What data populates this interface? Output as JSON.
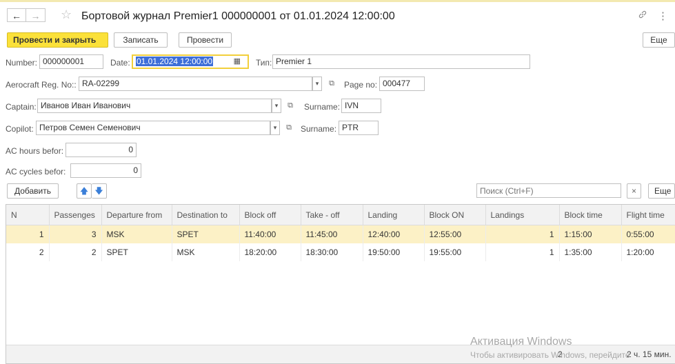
{
  "window": {
    "title": "Бортовой журнал Premier1 000000001 от 01.01.2024 12:00:00",
    "back": "←",
    "forward": "→",
    "star": "☆",
    "link_icon": "🔗",
    "more_icon": "⋮"
  },
  "toolbar": {
    "post_close": "Провести и закрыть",
    "save": "Записать",
    "post": "Провести",
    "more": "Еще"
  },
  "form": {
    "number_label": "Number:",
    "number_value": "000000001",
    "date_label": "Date:",
    "date_value": "01.01.2024 12:00:00",
    "type_label": "Тип:",
    "type_value": "Premier 1",
    "reg_label": "Aerocraft Reg. No::",
    "reg_value": "RA-02299",
    "page_label": "Page no:",
    "page_value": "000477",
    "captain_label": "Captain:",
    "captain_value": "Иванов Иван Иванович",
    "captain_surname_label": "Surname:",
    "captain_surname_value": "IVN",
    "copilot_label": "Copilot:",
    "copilot_value": "Петров Семен Семенович",
    "copilot_surname_label": "Surname:",
    "copilot_surname_value": "PTR",
    "ac_hours_label": "AC hours befor:",
    "ac_hours_value": "0",
    "ac_cycles_label": "AC cycles befor:",
    "ac_cycles_value": "0"
  },
  "table_toolbar": {
    "add": "Добавить",
    "up": "🡅",
    "down": "🡇",
    "search_placeholder": "Поиск (Ctrl+F)",
    "clear": "×",
    "more": "Еще"
  },
  "table": {
    "columns": [
      "N",
      "Passenges",
      "Departure from",
      "Destination to",
      "Block off",
      "Take - off",
      "Landing",
      "Block ON",
      "Landings",
      "Block time",
      "Flight time"
    ],
    "rows": [
      {
        "n": "1",
        "passengers": "3",
        "from": "MSK",
        "to": "SPET",
        "block_off": "11:40:00",
        "takeoff": "11:45:00",
        "landing": "12:40:00",
        "block_on": "12:55:00",
        "landings": "1",
        "block_time": "1:15:00",
        "flight_time": "0:55:00",
        "selected": true
      },
      {
        "n": "2",
        "passengers": "2",
        "from": "SPET",
        "to": "MSK",
        "block_off": "18:20:00",
        "takeoff": "18:30:00",
        "landing": "19:50:00",
        "block_on": "19:55:00",
        "landings": "1",
        "block_time": "1:35:00",
        "flight_time": "1:20:00",
        "selected": false
      }
    ],
    "footer_landings": "2",
    "footer_block_time": "2 ч. 15 мин."
  },
  "watermark": {
    "line1": "Активация Windows",
    "line2": "Чтобы активировать Windows, перейдите"
  },
  "colors": {
    "accent": "#fbe13a",
    "selected_row": "#fcf1c6",
    "focus_border": "#f2cf3a",
    "selection": "#3d6ed8"
  }
}
